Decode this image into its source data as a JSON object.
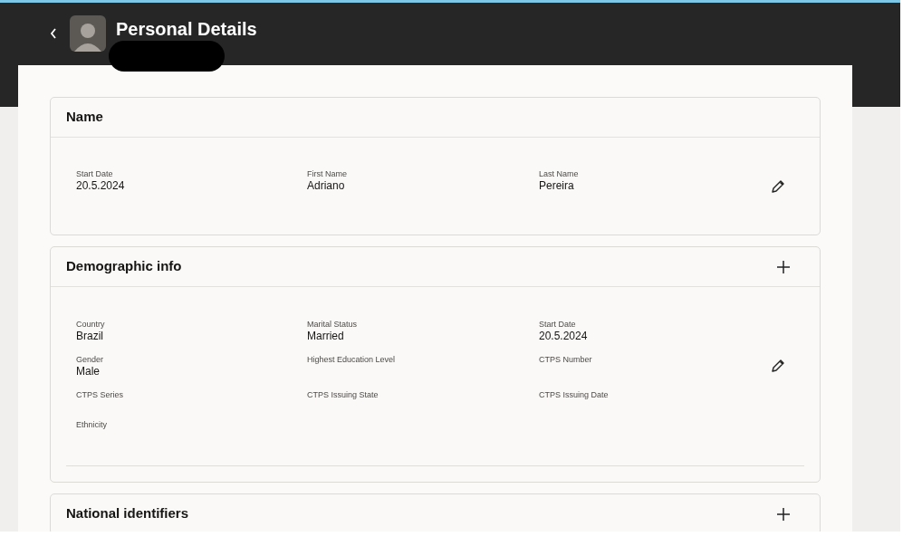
{
  "header": {
    "title": "Personal Details"
  },
  "sections": [
    {
      "title": "Name",
      "add_button": false,
      "editable": true,
      "bottom_rule": false,
      "fields": [
        {
          "label": "Start Date",
          "value": "20.5.2024"
        },
        {
          "label": "First Name",
          "value": "Adriano"
        },
        {
          "label": "Last Name",
          "value": "Pereira"
        }
      ]
    },
    {
      "title": "Demographic info",
      "add_button": true,
      "editable": true,
      "bottom_rule": true,
      "fields": [
        {
          "label": "Country",
          "value": "Brazil"
        },
        {
          "label": "Marital Status",
          "value": "Married"
        },
        {
          "label": "Start Date",
          "value": "20.5.2024"
        },
        {
          "label": "Gender",
          "value": "Male"
        },
        {
          "label": "Highest Education Level"
        },
        {
          "label": "CTPS Number"
        },
        {
          "label": "CTPS Series"
        },
        {
          "label": "CTPS Issuing State"
        },
        {
          "label": "CTPS Issuing Date"
        },
        {
          "label": "Ethnicity"
        }
      ]
    },
    {
      "title": "National identifiers",
      "add_button": true,
      "editable": false,
      "bottom_rule": false
    }
  ]
}
